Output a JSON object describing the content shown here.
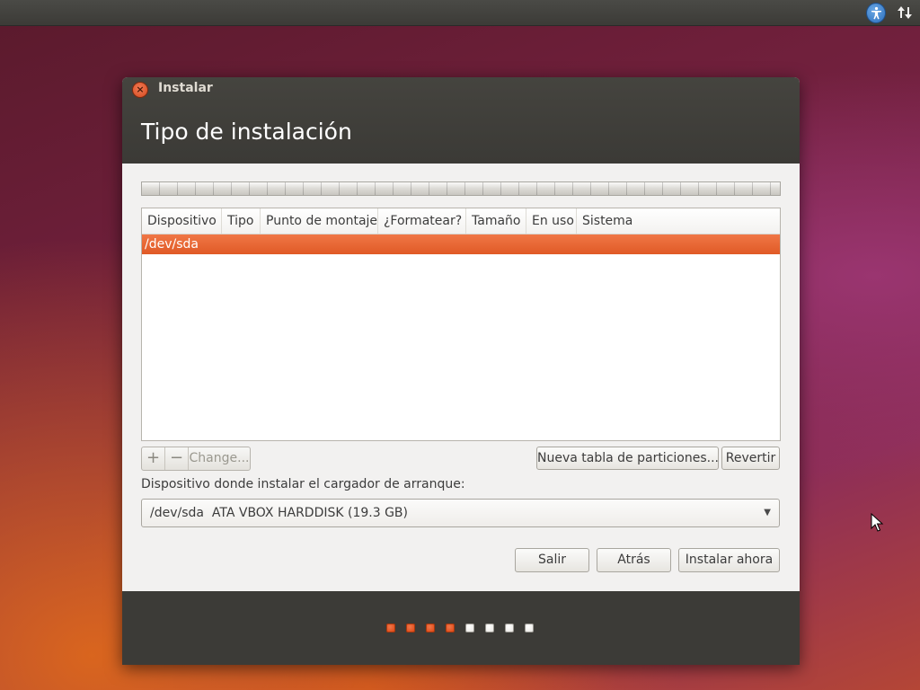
{
  "window": {
    "title": "Instalar",
    "page_title": "Tipo de instalación"
  },
  "partition_table": {
    "columns": [
      "Dispositivo",
      "Tipo",
      "Punto de montaje",
      "¿Formatear?",
      "Tamaño",
      "En uso",
      "Sistema"
    ],
    "rows": [
      {
        "device": "/dev/sda",
        "selected": true
      }
    ]
  },
  "toolbar": {
    "add": "+",
    "remove": "−",
    "change": "Change..."
  },
  "buttons": {
    "new_table": "Nueva tabla de particiones...",
    "revert": "Revertir",
    "quit": "Salir",
    "back": "Atrás",
    "install": "Instalar ahora"
  },
  "bootloader": {
    "label": "Dispositivo donde instalar el cargador de arranque:",
    "selected": "/dev/sda  ATA VBOX HARDDISK (19.3 GB)"
  },
  "progress_steps": {
    "total": 8,
    "completed": 4,
    "done_color": "#dd4814",
    "pending_color": "#e8e6e1"
  },
  "colors": {
    "accent": "#e8642b",
    "titlebar": "#3c3b37"
  }
}
